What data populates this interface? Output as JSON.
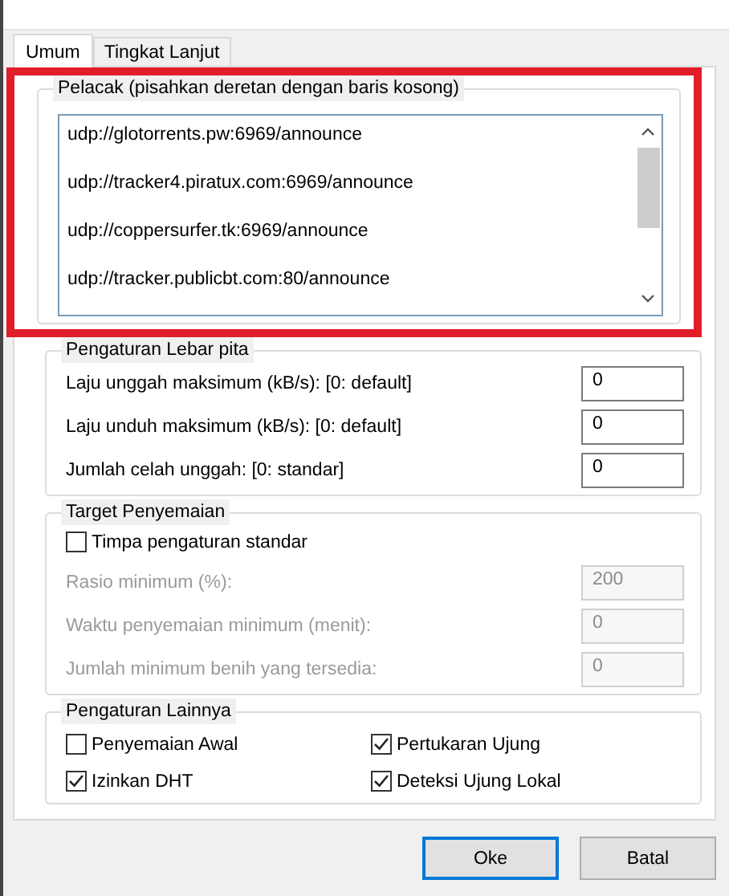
{
  "tabs": [
    {
      "label": "Umum",
      "selected": true
    },
    {
      "label": "Tingkat Lanjut",
      "selected": false
    }
  ],
  "trackers": {
    "label": "Pelacak (pisahkan deretan dengan baris kosong)",
    "highlighted": true,
    "lines": [
      "udp://glotorrents.pw:6969/announce",
      "udp://tracker4.piratux.com:6969/announce",
      "udp://coppersurfer.tk:6969/announce",
      "udp://tracker.publicbt.com:80/announce"
    ]
  },
  "bandwidth": {
    "label": "Pengaturan Lebar pita",
    "rows": [
      {
        "label": "Laju unggah maksimum (kB/s): [0: default]",
        "value": "0",
        "disabled": false
      },
      {
        "label": "Laju unduh maksimum (kB/s): [0: default]",
        "value": "0",
        "disabled": false
      },
      {
        "label": "Jumlah celah unggah: [0: standar]",
        "value": "0",
        "disabled": false
      }
    ]
  },
  "seeding": {
    "label": "Target Penyemaian",
    "override": {
      "label": "Timpa pengaturan standar",
      "checked": false
    },
    "rows": [
      {
        "label": "Rasio minimum (%):",
        "value": "200",
        "disabled": true
      },
      {
        "label": "Waktu penyemaian minimum (menit):",
        "value": "0",
        "disabled": true
      },
      {
        "label": "Jumlah minimum benih yang tersedia:",
        "value": "0",
        "disabled": true
      }
    ]
  },
  "other": {
    "label": "Pengaturan Lainnya",
    "options": [
      {
        "label": "Penyemaian Awal",
        "checked": false
      },
      {
        "label": "Pertukaran Ujung",
        "checked": true
      },
      {
        "label": "Izinkan DHT",
        "checked": true
      },
      {
        "label": "Deteksi Ujung Lokal",
        "checked": true
      }
    ]
  },
  "buttons": [
    {
      "label": "Oke",
      "focused": true
    },
    {
      "label": "Batal",
      "focused": false
    }
  ]
}
